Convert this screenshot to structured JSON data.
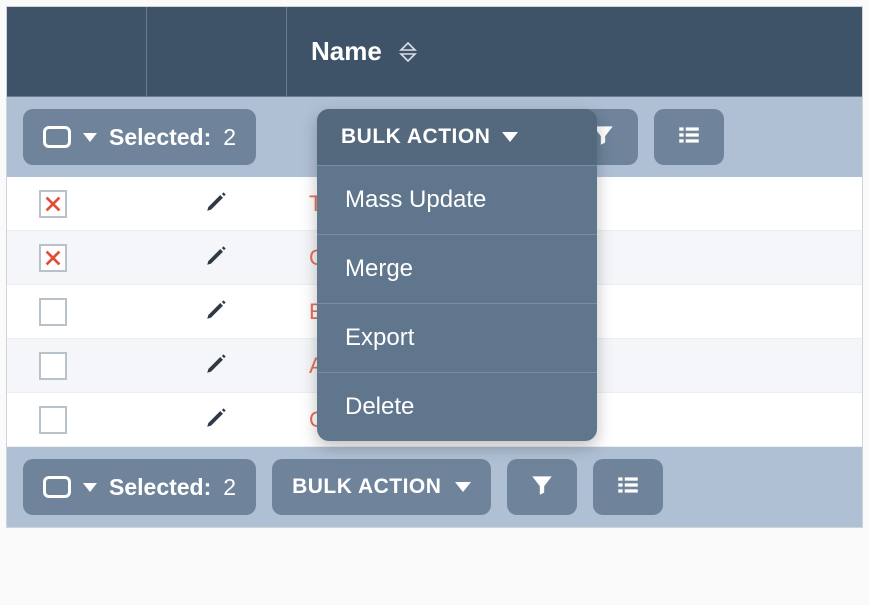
{
  "header": {
    "columns": {
      "name": "Name"
    }
  },
  "toolbar": {
    "selected_label": "Selected:",
    "selected_count": "2",
    "bulk_action_label": "Bulk Action",
    "menu": {
      "mass_update": "Mass Update",
      "merge": "Merge",
      "export": "Export",
      "delete": "Delete"
    }
  },
  "rows": [
    {
      "checked": true,
      "name": "T… …al Worlds"
    },
    {
      "checked": true,
      "name": "C…"
    },
    {
      "checked": false,
      "name": "E… …is"
    },
    {
      "checked": false,
      "name": "A…"
    },
    {
      "checked": false,
      "name": "C…"
    }
  ]
}
